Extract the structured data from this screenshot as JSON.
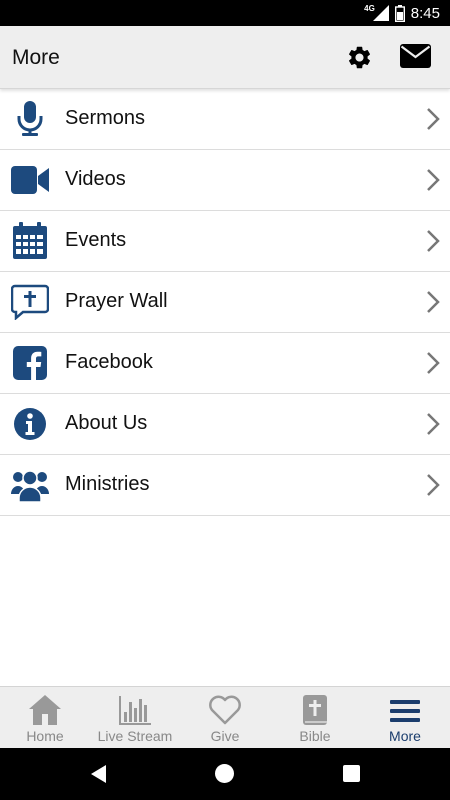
{
  "status_bar": {
    "network": "4G",
    "time": "8:45"
  },
  "app_bar": {
    "title": "More"
  },
  "menu": [
    {
      "label": "Sermons",
      "icon": "microphone-icon"
    },
    {
      "label": "Videos",
      "icon": "video-camera-icon"
    },
    {
      "label": "Events",
      "icon": "calendar-icon"
    },
    {
      "label": "Prayer Wall",
      "icon": "prayer-bubble-icon"
    },
    {
      "label": "Facebook",
      "icon": "facebook-icon"
    },
    {
      "label": "About Us",
      "icon": "info-icon"
    },
    {
      "label": "Ministries",
      "icon": "people-group-icon"
    }
  ],
  "bottom_nav": [
    {
      "label": "Home",
      "icon": "home-icon",
      "active": false
    },
    {
      "label": "Live Stream",
      "icon": "live-stream-icon",
      "active": false
    },
    {
      "label": "Give",
      "icon": "heart-icon",
      "active": false
    },
    {
      "label": "Bible",
      "icon": "bible-icon",
      "active": false
    },
    {
      "label": "More",
      "icon": "menu-icon",
      "active": true
    }
  ],
  "colors": {
    "accent": "#1b3d6d",
    "inactive": "#888888",
    "icon_blue": "#1d4a7e"
  }
}
